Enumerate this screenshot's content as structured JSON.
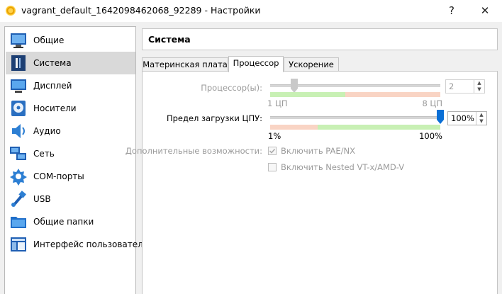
{
  "window": {
    "title": "vagrant_default_1642098462068_92289 - Настройки",
    "help_glyph": "?",
    "close_glyph": "✕"
  },
  "sidebar": {
    "items": [
      {
        "label": "Общие",
        "icon": "general-icon"
      },
      {
        "label": "Система",
        "icon": "system-icon"
      },
      {
        "label": "Дисплей",
        "icon": "display-icon"
      },
      {
        "label": "Носители",
        "icon": "storage-icon"
      },
      {
        "label": "Аудио",
        "icon": "audio-icon"
      },
      {
        "label": "Сеть",
        "icon": "network-icon"
      },
      {
        "label": "COM-порты",
        "icon": "com-ports-icon"
      },
      {
        "label": "USB",
        "icon": "usb-icon"
      },
      {
        "label": "Общие папки",
        "icon": "shared-folders-icon"
      },
      {
        "label": "Интерфейс пользователя",
        "icon": "user-interface-icon"
      }
    ],
    "selected_label": "Система"
  },
  "section": {
    "title": "Система"
  },
  "tabs": [
    {
      "label": "Материнская плата"
    },
    {
      "label": "Процессор"
    },
    {
      "label": "Ускорение"
    }
  ],
  "active_tab": "Процессор",
  "processor": {
    "cpu_label": "Процессор(ы):",
    "cpu_value": "2",
    "cpu_min_label": "1 ЦП",
    "cpu_max_label": "8 ЦП",
    "cpu_level": 0.14,
    "cap_label": "Предел загрузки ЦПУ:",
    "cap_value": "100%",
    "cap_min_label": "1%",
    "cap_max_label": "100%",
    "cap_level": 1.0,
    "extended_label": "Дополнительные возможности:",
    "pae_label": "Включить PAE/NX",
    "pae_checked": true,
    "nested_label": "Включить Nested VT-x/AMD-V",
    "nested_checked": false
  },
  "colors": {
    "scale_green": "#c8f0b4",
    "scale_red": "#f9d4c4",
    "thumb_blue": "#0a6fd6",
    "thumb_disabled": "#c9c9c9",
    "selected_bg": "#d9d9d9"
  }
}
